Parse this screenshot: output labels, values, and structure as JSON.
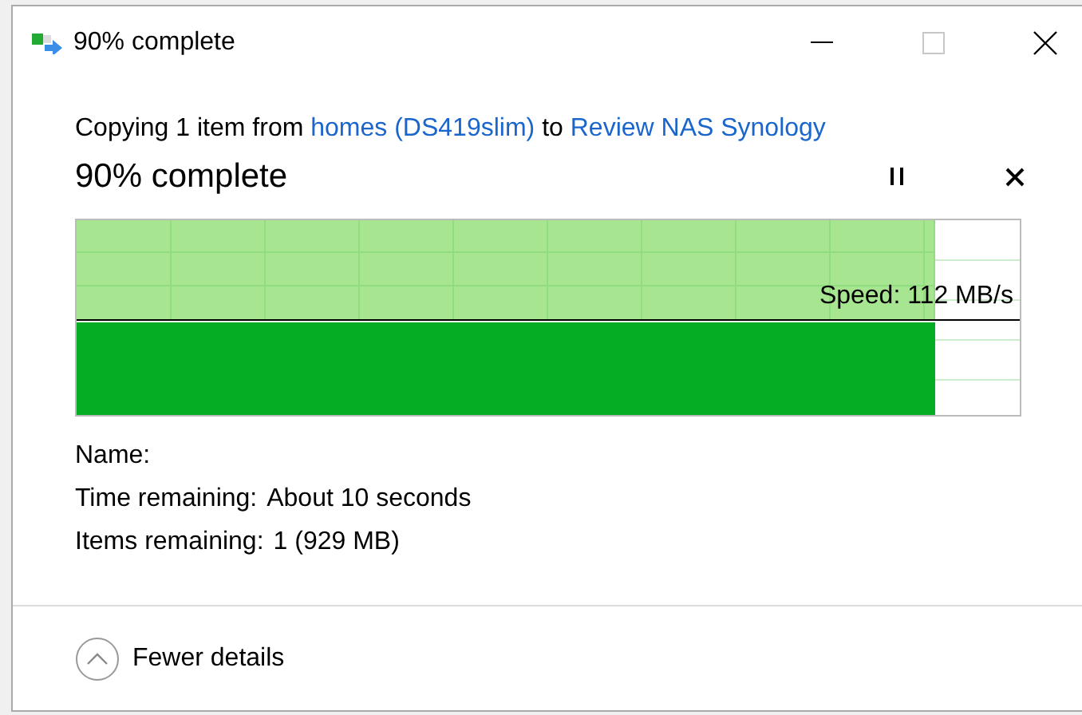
{
  "window": {
    "title": "90% complete"
  },
  "message": {
    "prefix": "Copying 1 item from",
    "source": "homes (DS419slim)",
    "middle": "to",
    "destination": "Review NAS Synology"
  },
  "status": "90% complete",
  "progress": {
    "level": 0.91,
    "speed": "Speed: 112 MB/s"
  },
  "details": [
    {
      "label": "Name:"
    },
    {
      "label": "Time remaining:",
      "value": "About 10 seconds"
    },
    {
      "label": "Items remaining:",
      "value": "1 (929 MB)"
    }
  ],
  "toggle": {
    "label": "Fewer details",
    "expanded": true
  }
}
